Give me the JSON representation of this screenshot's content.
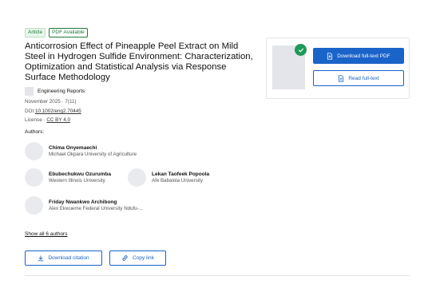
{
  "badges": {
    "article": "Article",
    "pdf": "PDF Available"
  },
  "title": "Anticorrosion Effect of Pineapple Peel Extract on Mild Steel in Hydrogen Sulfide Environment: Characterization, Optimization and Statistical Analysis via Response Surface Methodology",
  "journal": {
    "name": "Engineering Reports"
  },
  "meta": {
    "date": "November 2025 · 7(11)",
    "doi_prefix": "DOI:",
    "doi": "10.1002/eng2.70445",
    "license_prefix": "License · ",
    "license": "CC BY 4.0"
  },
  "authors_heading": "Authors:",
  "authors": [
    {
      "name": "Chima Onyemaechi",
      "affiliation": "Michael Okpara University of Agriculture"
    },
    {
      "name": "Ebubechukwu Ozurumba",
      "affiliation": "Western Illinois University"
    },
    {
      "name": "Lekan Taofeek Popoola",
      "affiliation": "Afe Babalola University"
    },
    {
      "name": "Friday Nwankwo Archibong",
      "affiliation": "Alex Ekwueme Federal University Ndufu-..."
    }
  ],
  "show_all": "Show all 6 authors",
  "actions": {
    "download_citation": "Download citation",
    "copy_link": "Copy link"
  },
  "panel": {
    "download_pdf": "Download full-text PDF",
    "read_full_text": "Read full-text"
  },
  "colors": {
    "accent": "#1a63c9",
    "success": "#1d9a56",
    "badge_green": "#1f7a3a"
  },
  "icons": [
    "check-icon",
    "file-download-icon",
    "document-icon",
    "download-icon",
    "link-icon"
  ]
}
